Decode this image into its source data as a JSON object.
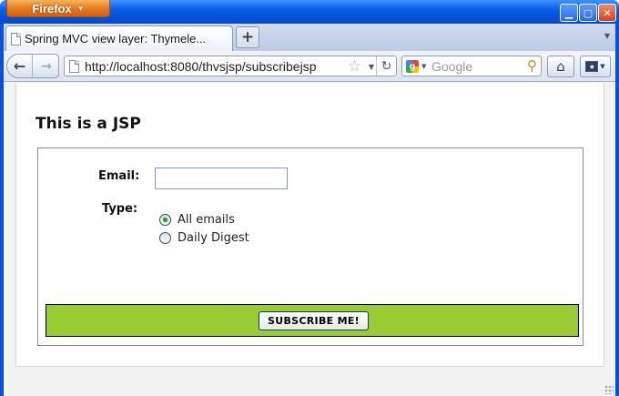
{
  "window": {
    "app_button_label": "Firefox",
    "min_glyph": "▁",
    "max_glyph": "▢",
    "close_glyph": "✕"
  },
  "tabs": [
    {
      "title": "Spring MVC view layer: Thymele..."
    }
  ],
  "tabstrip": {
    "new_tab_glyph": "+"
  },
  "navbar": {
    "back_glyph": "←",
    "forward_glyph": "→",
    "url": "http://localhost:8080/thvsjsp/subscribejsp",
    "search_placeholder": "Google",
    "icons": {
      "back": "back-arrow-icon",
      "forward": "forward-arrow-icon",
      "page": "page-icon",
      "bookmark_star": "star-icon",
      "reload": "reload-icon",
      "search_engine": "google-icon",
      "search": "magnifier-icon",
      "home": "home-icon",
      "bookmarks": "bookmarks-icon"
    }
  },
  "page": {
    "heading": "This is a JSP",
    "form": {
      "email_label": "Email:",
      "email_value": "",
      "type_label": "Type:",
      "type_options": [
        {
          "label": "All emails",
          "checked": true
        },
        {
          "label": "Daily Digest",
          "checked": false
        }
      ],
      "submit_label": "SUBSCRIBE ME!"
    }
  },
  "colors": {
    "window_frame": "#0a4fd8",
    "firefox_button": "#e4781b",
    "submit_bar": "#99cc33",
    "radio_checked": "#21a121"
  }
}
